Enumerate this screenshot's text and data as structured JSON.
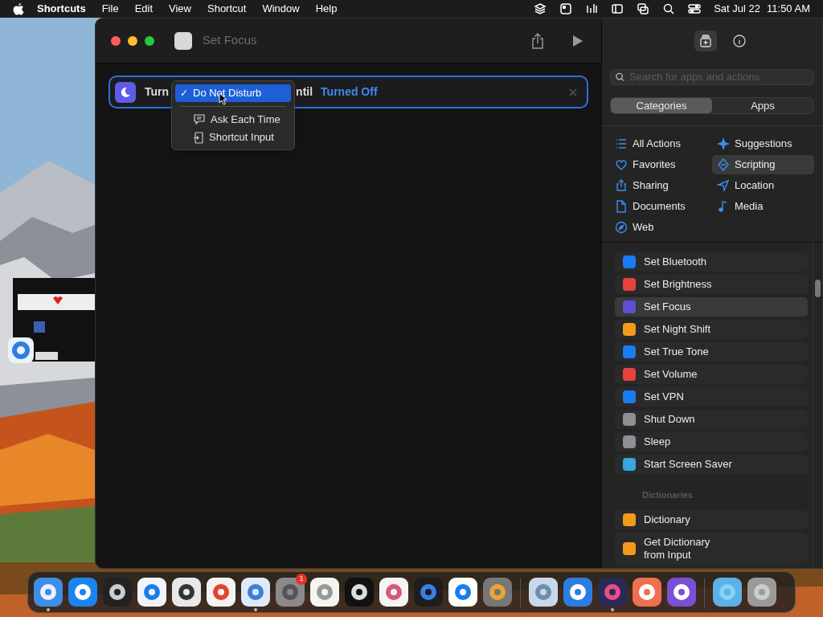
{
  "menu_bar": {
    "app": "Shortcuts",
    "menus": [
      "File",
      "Edit",
      "View",
      "Shortcut",
      "Window",
      "Help"
    ],
    "date": "Sat Jul 22",
    "time": "11:50 AM"
  },
  "window": {
    "title": "Set Focus"
  },
  "action": {
    "verb": "Turn",
    "after": "ntil",
    "state": "Turned Off"
  },
  "popup_menu": {
    "check": "✓",
    "items": [
      {
        "label": "Do Not Disturb",
        "kind": "choice",
        "selected": true
      },
      {
        "label": "Ask Each Time",
        "kind": "ask",
        "selected": false
      },
      {
        "label": "Shortcut Input",
        "kind": "input",
        "selected": false
      }
    ]
  },
  "sidebar": {
    "search": {
      "placeholder": "Search for apps and actions"
    },
    "segments": [
      {
        "label": "Categories",
        "selected": true
      },
      {
        "label": "Apps",
        "selected": false
      }
    ],
    "categories": [
      {
        "label": "All Actions",
        "kind": "list",
        "selected": false
      },
      {
        "label": "Suggestions",
        "kind": "sparkle",
        "selected": false
      },
      {
        "label": "Favorites",
        "kind": "heart",
        "selected": false
      },
      {
        "label": "Scripting",
        "kind": "script",
        "selected": true
      },
      {
        "label": "Sharing",
        "kind": "share",
        "selected": false
      },
      {
        "label": "Location",
        "kind": "location",
        "selected": false
      },
      {
        "label": "Documents",
        "kind": "doc",
        "selected": false
      },
      {
        "label": "Media",
        "kind": "music",
        "selected": false
      },
      {
        "label": "Web",
        "kind": "compass",
        "selected": false
      }
    ],
    "actions": [
      {
        "label": "Set Bluetooth",
        "color": "#1a7cf0",
        "selected": false
      },
      {
        "label": "Set Brightness",
        "color": "#e8413c",
        "selected": false
      },
      {
        "label": "Set Focus",
        "color": "#5e4fd6",
        "selected": true
      },
      {
        "label": "Set Night Shift",
        "color": "#f39a1c",
        "selected": false
      },
      {
        "label": "Set True Tone",
        "color": "#1a7cf0",
        "selected": false
      },
      {
        "label": "Set Volume",
        "color": "#e8413c",
        "selected": false
      },
      {
        "label": "Set VPN",
        "color": "#1a7cf0",
        "selected": false
      },
      {
        "label": "Shut Down",
        "color": "#8e8e93",
        "selected": false
      },
      {
        "label": "Sleep",
        "color": "#8e8e93",
        "selected": false
      },
      {
        "label": "Start Screen Saver",
        "color": "#3aa6e0",
        "selected": false
      }
    ],
    "section": "Dictionaries",
    "section_actions": [
      {
        "label": "Dictionary",
        "color": "#f39a1c",
        "selected": false
      },
      {
        "label": "Get Dictionary from Input",
        "color": "#f39a1c",
        "selected": false
      }
    ]
  },
  "dock": [
    {
      "kind": "finder",
      "running": true
    },
    {
      "kind": "appstore",
      "running": false
    },
    {
      "kind": "windows",
      "running": false
    },
    {
      "kind": "safari",
      "running": false
    },
    {
      "kind": "screenshot",
      "running": false
    },
    {
      "kind": "chrome",
      "running": false
    },
    {
      "kind": "chromium",
      "running": true
    },
    {
      "kind": "settings",
      "running": false,
      "badge": "1"
    },
    {
      "kind": "notes",
      "running": false
    },
    {
      "kind": "terminal",
      "running": false
    },
    {
      "kind": "bars",
      "running": false
    },
    {
      "kind": "audio",
      "running": false
    },
    {
      "kind": "vscode",
      "running": false
    },
    {
      "kind": "launchpad",
      "running": false
    },
    {
      "kind": "sep"
    },
    {
      "kind": "preview",
      "running": false
    },
    {
      "kind": "xcode",
      "running": false
    },
    {
      "kind": "shortcuts",
      "running": true
    },
    {
      "kind": "layers",
      "running": false
    },
    {
      "kind": "layers2",
      "running": false
    },
    {
      "kind": "sep"
    },
    {
      "kind": "folder",
      "running": false
    },
    {
      "kind": "trash",
      "running": false
    }
  ]
}
